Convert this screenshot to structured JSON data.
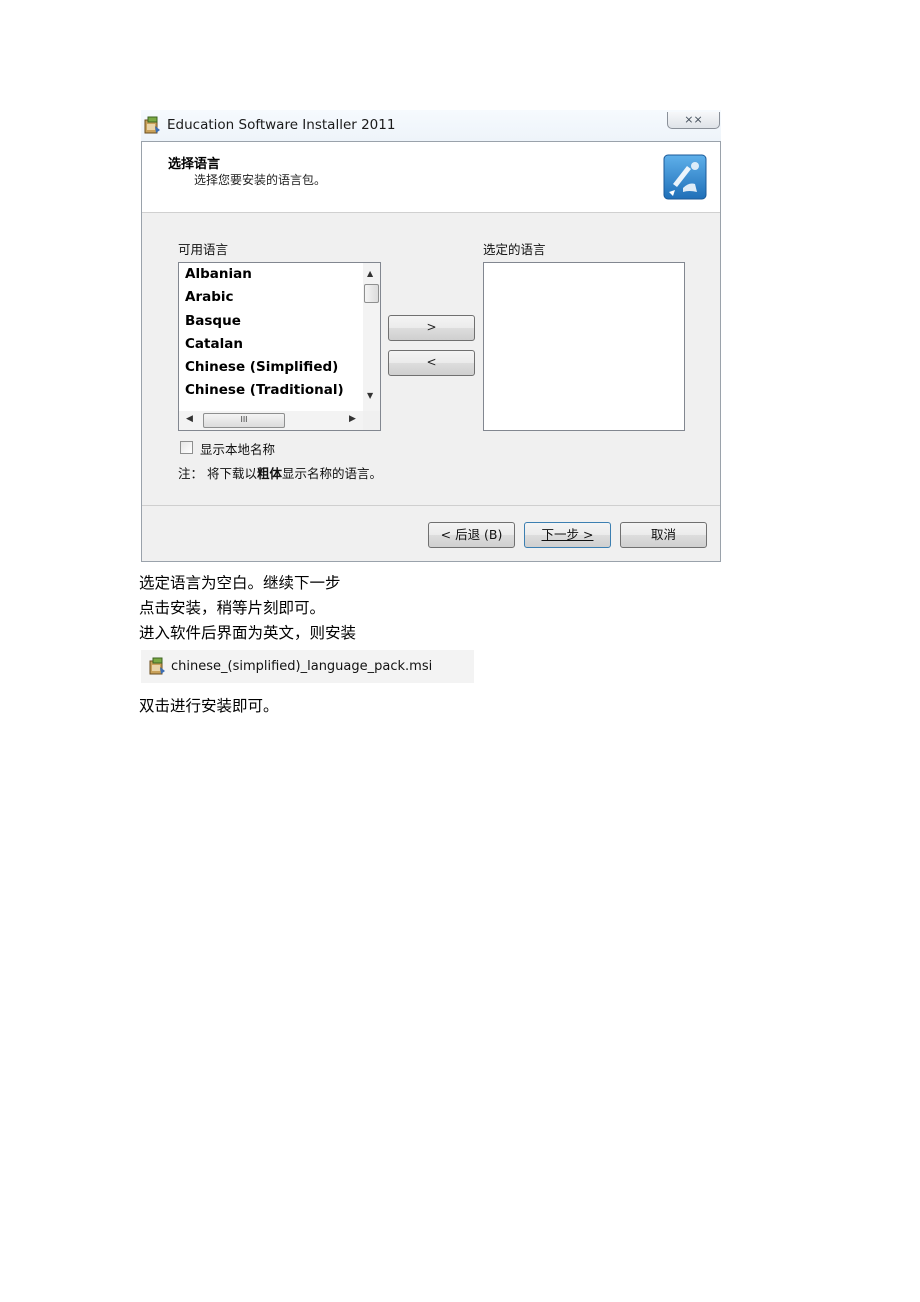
{
  "dialog": {
    "title": "Education Software Installer 2011",
    "close_glyph": "⨯⨯",
    "header_title": "选择语言",
    "header_subtitle": "选择您要安装的语言包。",
    "available_label": "可用语言",
    "selected_label": "选定的语言",
    "languages": [
      "Albanian",
      "Arabic",
      "Basque",
      "Catalan",
      "Chinese (Simplified)",
      "Chinese (Traditional)"
    ],
    "add_button": ">",
    "remove_button": "<",
    "show_native_label": "显示本地名称",
    "note_prefix": "注：  将下载以",
    "note_bold": "粗体",
    "note_suffix": "显示名称的语言。",
    "back_button": "< 后退 (B)",
    "next_button": "下一步 >",
    "cancel_button": "取消",
    "hscroll_grip": "III"
  },
  "doc": {
    "line1": "选定语言为空白。继续下一步",
    "line2": "点击安装，稍等片刻即可。",
    "line3": "进入软件后界面为英文，则安装",
    "file_name": "chinese_(simplified)_language_pack.msi",
    "line4": "双击进行安装即可。"
  },
  "colors": {
    "frame_bg": "#f0f0f0",
    "header_bg": "#ffffff",
    "icon_blue": "#2f7fc4"
  },
  "icons": {
    "installer": "installer-icon",
    "header": "language-wizard-icon",
    "msi": "msi-package-icon"
  }
}
